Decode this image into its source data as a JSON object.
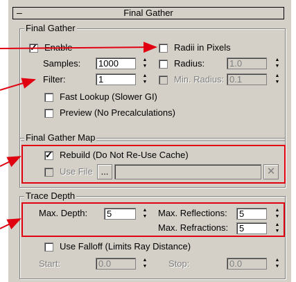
{
  "rollout": {
    "title": "Final Gather",
    "toggle": "–"
  },
  "final_gather": {
    "legend": "Final Gather",
    "enable_label": "Enable",
    "radii_label": "Radii in Pixels",
    "samples_label": "Samples:",
    "samples_value": "1000",
    "radius_label": "Radius:",
    "radius_value": "1.0",
    "filter_label": "Filter:",
    "filter_value": "1",
    "min_radius_label": "Min. Radius:",
    "min_radius_value": "0.1",
    "fast_lookup_label": "Fast Lookup (Slower GI)",
    "preview_label": "Preview (No Precalculations)"
  },
  "fg_map": {
    "legend": "Final Gather Map",
    "rebuild_label": "Rebuild (Do Not Re-Use Cache)",
    "use_file_label": "Use File",
    "browse_label": "...",
    "clear_label": "✕"
  },
  "trace_depth": {
    "legend": "Trace Depth",
    "max_depth_label": "Max. Depth:",
    "max_depth_value": "5",
    "max_reflections_label": "Max. Reflections:",
    "max_reflections_value": "5",
    "max_refractions_label": "Max. Refractions:",
    "max_refractions_value": "5",
    "use_falloff_label": "Use Falloff (Limits Ray Distance)",
    "start_label": "Start:",
    "start_value": "0.0",
    "stop_label": "Stop:",
    "stop_value": "0.0"
  },
  "colors": {
    "panel": "#d4d0c8",
    "highlight": "#e00010"
  }
}
